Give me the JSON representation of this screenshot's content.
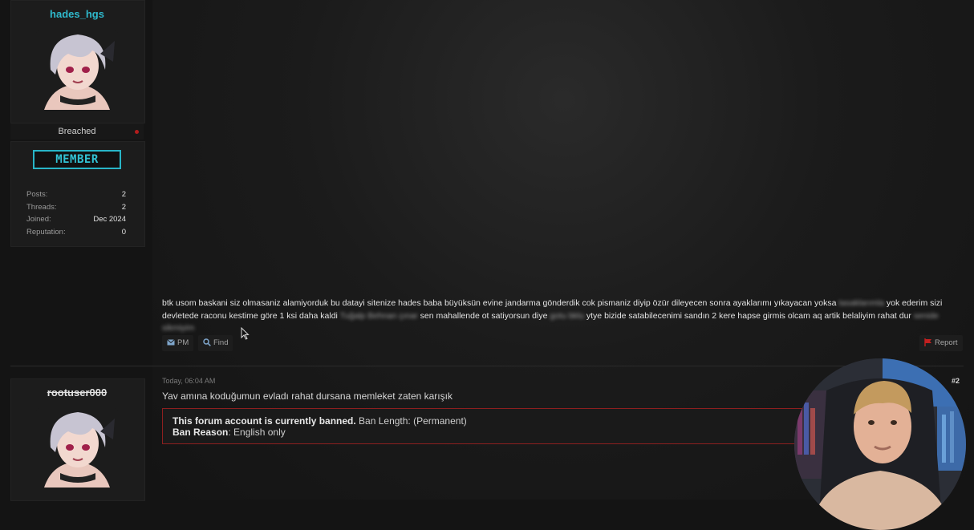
{
  "post1": {
    "author": {
      "username": "hades_hgs",
      "group": "Breached",
      "badge": "MEMBER",
      "stats": [
        {
          "label": "Posts:",
          "value": "2"
        },
        {
          "label": "Threads:",
          "value": "2"
        },
        {
          "label": "Joined:",
          "value": "Dec 2024"
        },
        {
          "label": "Reputation:",
          "value": "0"
        }
      ]
    },
    "body": {
      "part1": "btk usom baskani siz olmasaniz alamiyorduk bu datayi sitenize hades baba büyüksün evine jandarma gönderdik cok pismaniz diyip özür dileyecen sonra ayaklarımı yıkayacan yoksa",
      "blur1": "tasaklarımla",
      "part2": "yok ederim sizi devletede raconu kestime göre 1 ksi daha kaldi",
      "blur2": "Tuğalp Behnan çınar",
      "part3": "sen mahallende ot satiyorsun diye",
      "blur3": "gotu bklu",
      "part4": "ytye bizide satabilecenimi sandın 2 kere hapse girmis olcam aq artik belaliyim rahat dur",
      "blur4": "senide sikmiyim"
    },
    "buttons": {
      "pm": "PM",
      "find": "Find",
      "report": "Report"
    }
  },
  "post2": {
    "author": {
      "username": "rootuser000"
    },
    "timestamp": "Today, 06:04 AM",
    "post_number": "#2",
    "text": "Yav amına koduğumun evladı rahat dursana memleket zaten karışık",
    "ban": {
      "line1_bold": "This forum account is currently banned.",
      "line1_rest": " Ban Length: (Permanent)",
      "line2_bold": "Ban Reason",
      "line2_rest": ": English only"
    }
  },
  "colors": {
    "accent": "#28b5c7",
    "ban_border": "#8d1f1f",
    "report_flag": "#c42020"
  }
}
